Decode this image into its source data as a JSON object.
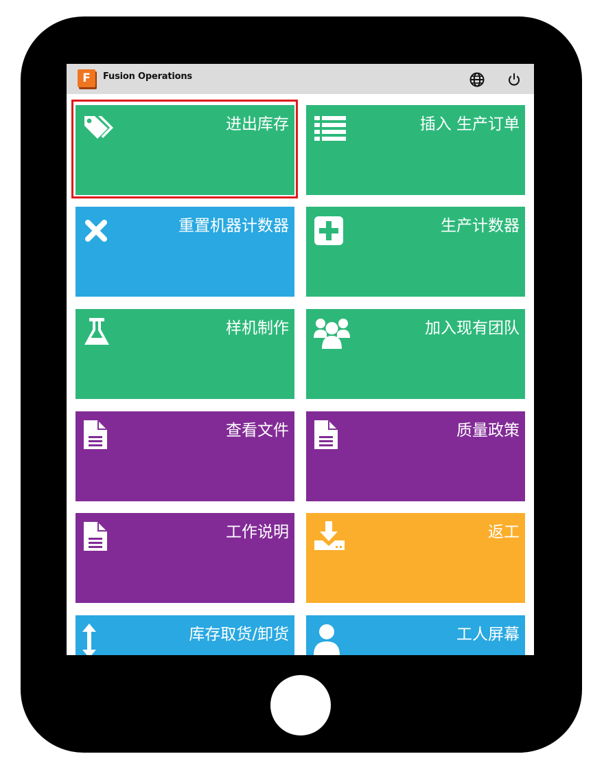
{
  "app": {
    "title": "Fusion Operations",
    "logo_letter": "F"
  },
  "header_icons": [
    "globe-icon",
    "power-icon"
  ],
  "colors": {
    "green": "#2db87a",
    "blue": "#29a8e1",
    "purple": "#822b96",
    "orange": "#fbae2c",
    "highlight": "#e01a1a"
  },
  "tiles": [
    {
      "label": "进出库存",
      "icon": "tags-icon",
      "color": "green"
    },
    {
      "label": "插入 生产订单",
      "icon": "list-icon",
      "color": "green"
    },
    {
      "label": "重置机器计数器",
      "icon": "x-icon",
      "color": "blue"
    },
    {
      "label": "生产计数器",
      "icon": "plus-square-icon",
      "color": "green"
    },
    {
      "label": "样机制作",
      "icon": "flask-icon",
      "color": "green"
    },
    {
      "label": "加入现有团队",
      "icon": "users-icon",
      "color": "green"
    },
    {
      "label": "查看文件",
      "icon": "document-icon",
      "color": "purple"
    },
    {
      "label": "质量政策",
      "icon": "document-icon",
      "color": "purple"
    },
    {
      "label": "工作说明",
      "icon": "document-icon",
      "color": "purple"
    },
    {
      "label": "返工",
      "icon": "download-icon",
      "color": "orange"
    },
    {
      "label": "库存取货/卸货",
      "icon": "vertical-arrows-icon",
      "color": "blue"
    },
    {
      "label": "工人屏幕",
      "icon": "user-icon",
      "color": "blue"
    }
  ]
}
